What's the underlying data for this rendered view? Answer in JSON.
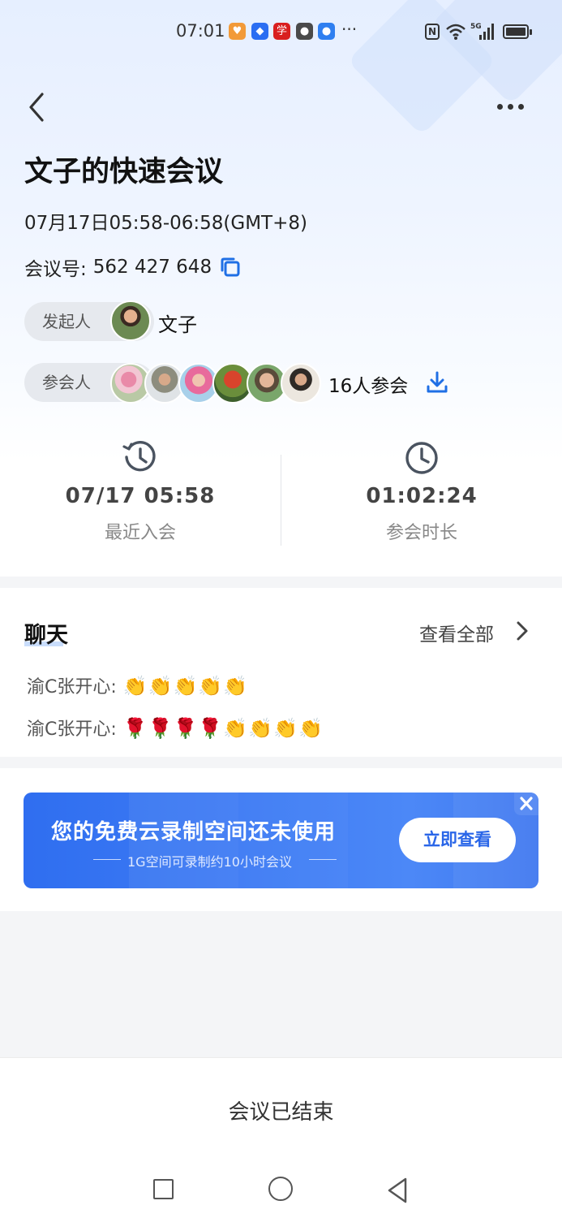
{
  "status_bar": {
    "time": "07:01",
    "more": "···",
    "network_label": "5G",
    "app_icons": [
      {
        "name": "app-shield-orange-icon",
        "color": "#f29a38",
        "glyph": "♥"
      },
      {
        "name": "app-shield-blue-icon",
        "color": "#2b6ef2",
        "glyph": "◆"
      },
      {
        "name": "app-xuexi-icon",
        "color": "#d91f1f",
        "glyph": "学"
      },
      {
        "name": "wechat-icon",
        "color": "#4a4a4a",
        "glyph": "●"
      },
      {
        "name": "app-blue-ball-icon",
        "color": "#2f7ff0",
        "glyph": "●"
      }
    ]
  },
  "meeting": {
    "title": "文子的快速会议",
    "time_range": "07月17日05:58-06:58(GMT+8)",
    "id_label": "会议号:",
    "id_value": "562 427 648",
    "host_label": "发起人",
    "host_name": "文子",
    "attendees_label": "参会人",
    "attendee_count": "16人参会"
  },
  "stats": {
    "recent_join_value": "07/17 05:58",
    "recent_join_label": "最近入会",
    "duration_value": "01:02:24",
    "duration_label": "参会时长"
  },
  "chat": {
    "title": "聊天",
    "view_all": "查看全部",
    "messages": [
      {
        "sender": "渝C张开心:",
        "content": "👏👏👏👏👏"
      },
      {
        "sender": "渝C张开心:",
        "content": "🌹🌹🌹🌹👏👏👏👏"
      }
    ]
  },
  "banner": {
    "title": "您的免费云录制空间还未使用",
    "subtitle": "1G空间可录制约10小时会议",
    "button": "立即查看"
  },
  "footer": {
    "status": "会议已结束"
  },
  "colors": {
    "accent": "#1f6fe5",
    "banner": "#3b78f2"
  }
}
